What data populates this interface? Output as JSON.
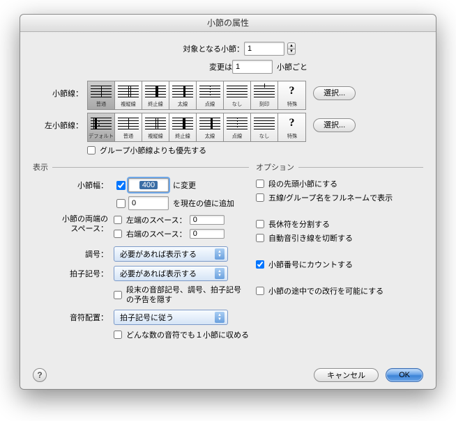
{
  "title": "小節の属性",
  "target": {
    "label": "対象となる小節：",
    "value": "1"
  },
  "change_every": {
    "label": "変更は",
    "value": "1",
    "unit": "小節ごと"
  },
  "barline": {
    "label": "小節線：",
    "styles": [
      "普通",
      "複縦線",
      "終止線",
      "太線",
      "点線",
      "なし",
      "刻印",
      "特殊"
    ],
    "selected": 0
  },
  "left_barline": {
    "label": "左小節線：",
    "styles": [
      "デフォルト",
      "普通",
      "複縦線",
      "終止線",
      "太線",
      "点線",
      "なし",
      "特殊"
    ],
    "selected": 0
  },
  "select_button": "選択...",
  "override_group": "グループ小節線よりも優先する",
  "display_header": "表示",
  "options_header": "オプション",
  "width": {
    "label": "小節幅：",
    "change_value": "400",
    "change_suffix": "に変更",
    "add_value": "0",
    "add_suffix": "を現在の値に追加"
  },
  "edge_spacing": {
    "label1": "小節の両端の",
    "label2": "スペース：",
    "left_label": "左端のスペース：",
    "left_value": "0",
    "right_label": "右端のスペース：",
    "right_value": "0"
  },
  "keysig": {
    "label": "調号：",
    "value": "必要があれば表示する"
  },
  "timesig": {
    "label": "拍子記号：",
    "value": "必要があれば表示する",
    "hide_cautionary": "段末の音部記号、調号、拍子記号の予告を隠す"
  },
  "note_placement": {
    "label": "音符配置：",
    "value": "拍子記号に従う",
    "fit_one": "どんな数の音符でも１小節に収める"
  },
  "options": {
    "begin_staff": "段の先頭小節にする",
    "full_names": "五線/グループ名をフルネームで表示",
    "split_rest": "長休符を分割する",
    "break_ties": "自動音引き線を切断する",
    "count_measure": "小節番号にカウントする",
    "allow_break": "小節の途中での改行を可能にする"
  },
  "buttons": {
    "cancel": "キャンセル",
    "ok": "OK"
  }
}
